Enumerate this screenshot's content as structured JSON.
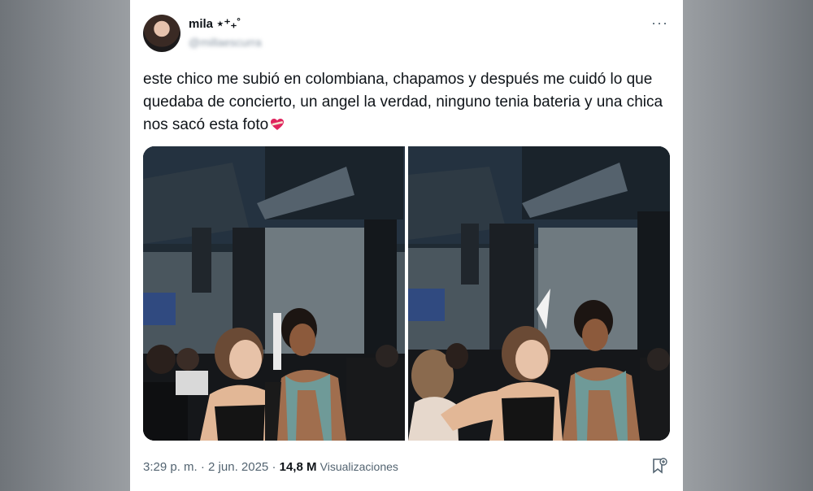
{
  "author": {
    "name": "mila ⋆⁺₊˚",
    "handle": "@millaescurra"
  },
  "post": {
    "text": "este chico me subió en colombiana, chapamos y después me cuidó lo que quedaba de concierto, un angel la verdad, ninguno tenia bateria y una chica nos sacó esta foto",
    "emoji": "heart-with-bandage",
    "time": "3:29 p. m.",
    "separator": " · ",
    "date": "2 jun. 2025",
    "views_count": "14,8 M",
    "views_label": "Visualizaciones"
  },
  "icons": {
    "more": "more-options-icon",
    "bookmark": "bookmark-icon"
  },
  "colors": {
    "text": "#0f1419",
    "secondary": "#536471",
    "heart": "#e0245e"
  }
}
